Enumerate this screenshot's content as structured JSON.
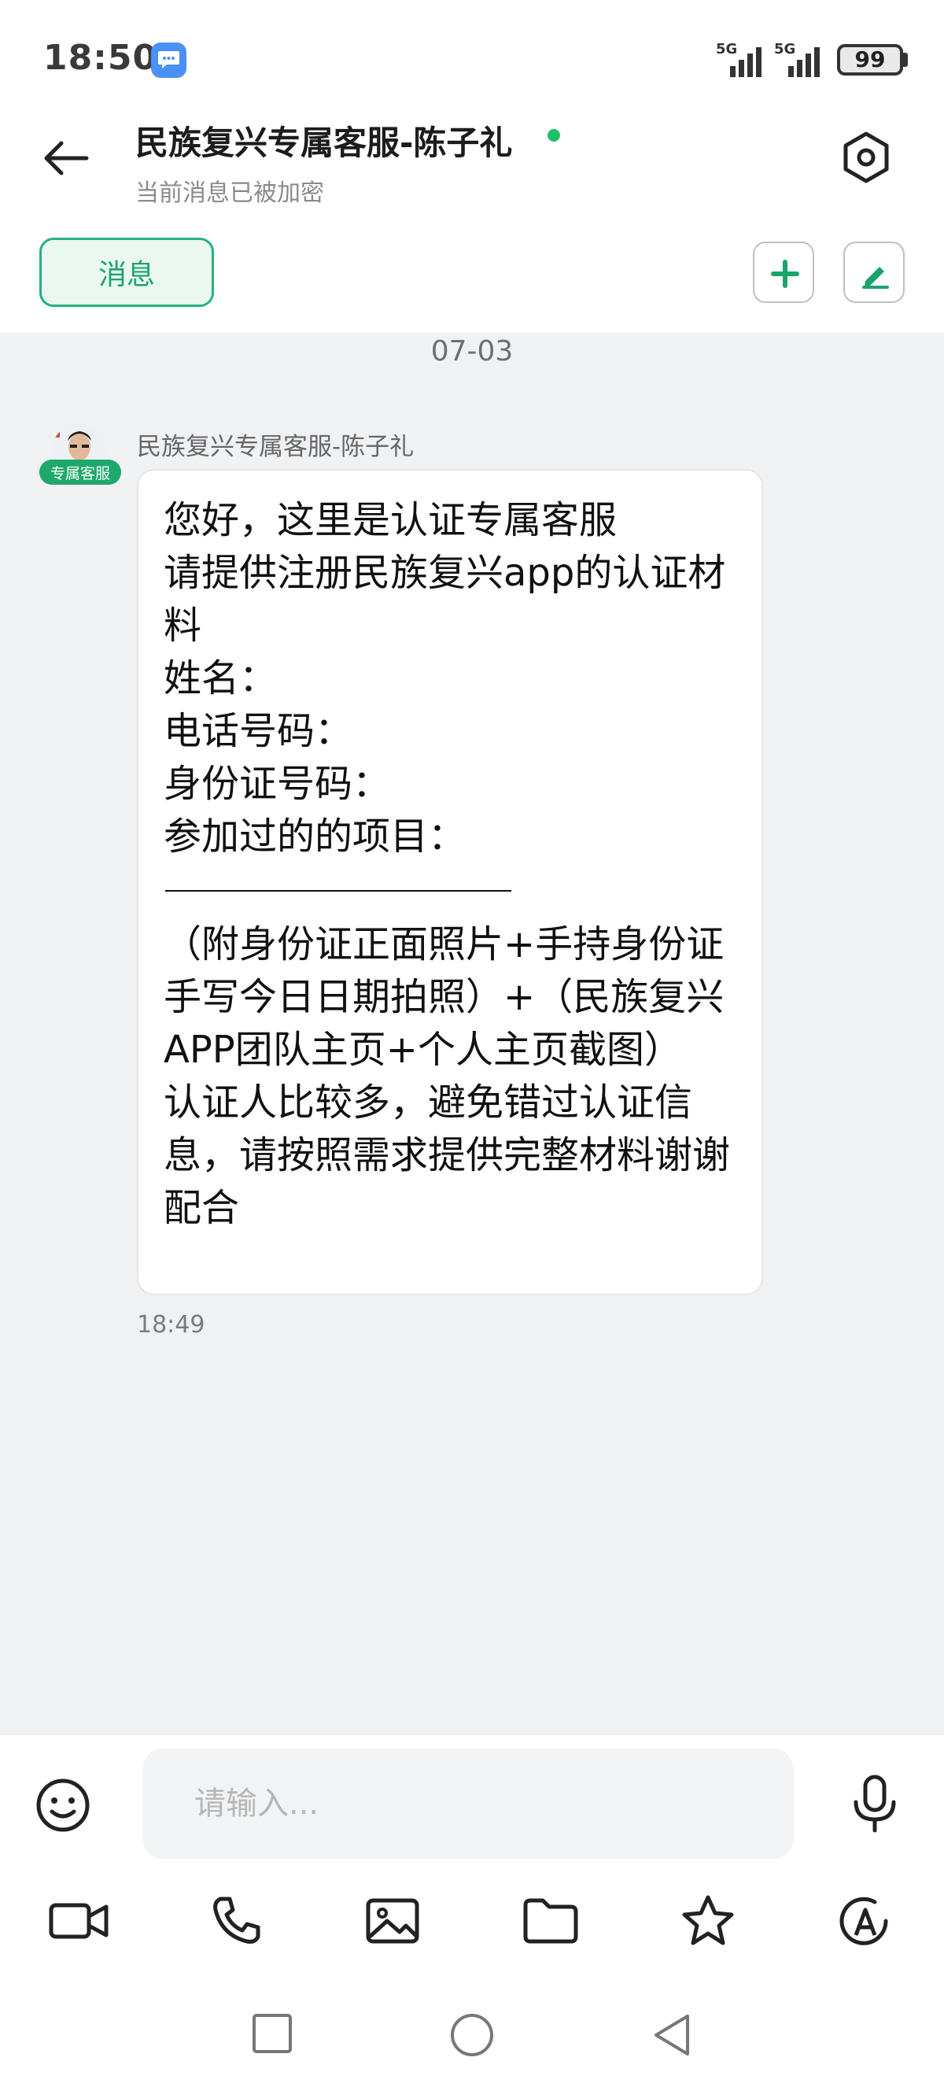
{
  "status_bar": {
    "time": "18:50",
    "network_1": "5G",
    "network_2": "5G",
    "battery": "99",
    "notification_icon": "message-bubble-icon"
  },
  "header": {
    "title": "民族复兴专属客服-陈子礼",
    "subtitle": "当前消息已被加密",
    "online": true,
    "online_color": "#1fbf6a",
    "back_icon": "arrow-left-icon",
    "settings_icon": "hexagon-settings-icon"
  },
  "tabs": {
    "message_label": "消息",
    "add_icon": "plus-icon",
    "edit_icon": "pen-icon",
    "accent_color": "#24b37a"
  },
  "conversation": {
    "date": "07-03",
    "messages": [
      {
        "sender": "民族复兴专属客服-陈子礼",
        "badge": "专属客服",
        "time": "18:49",
        "lines": [
          "您好，这里是认证专属客服",
          "请提供注册民族复兴app的认证材料",
          "姓名：",
          "电话号码：",
          "身份证号码：",
          "参加过的的项目："
        ],
        "lines_after": [
          "（附身份证正面照片+手持身份证手写今日日期拍照）+（民族复兴APP团队主页+个人主页截图）",
          "认证人比较多，避免错过认证信息，请按照需求提供完整材料谢谢配合"
        ]
      }
    ]
  },
  "composer": {
    "placeholder": "请输入...",
    "emoji_icon": "smiley-icon",
    "mic_icon": "microphone-icon",
    "tools": [
      "video-icon",
      "phone-icon",
      "image-icon",
      "folder-icon",
      "star-icon",
      "text-a-icon"
    ]
  },
  "system_nav": [
    "square-recents-icon",
    "circle-home-icon",
    "triangle-back-icon"
  ]
}
